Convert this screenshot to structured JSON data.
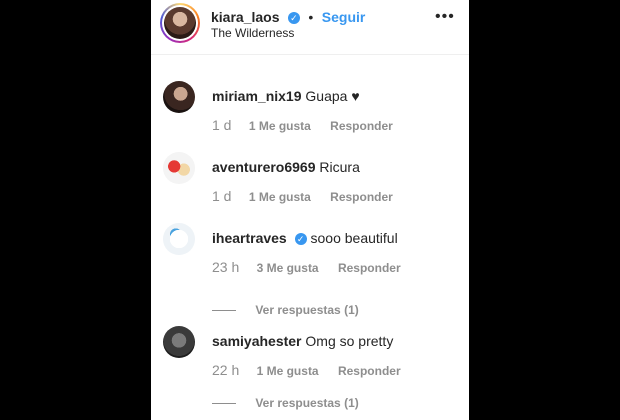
{
  "header": {
    "username": "kiara_laos",
    "verified_mark": "✓",
    "dot": "•",
    "follow_label": "Seguir",
    "location": "The Wilderness",
    "more_icon": "•••"
  },
  "comments": [
    {
      "username": "miriam_nix19",
      "text": "Guapa ♥",
      "verified": false,
      "time": "1 d",
      "likes": "1 Me gusta",
      "reply": "Responder",
      "replies": null
    },
    {
      "username": "aventurero6969",
      "text": "Ricura",
      "verified": false,
      "time": "1 d",
      "likes": "1 Me gusta",
      "reply": "Responder",
      "replies": null
    },
    {
      "username": "iheartraves",
      "text": "sooo beautiful",
      "verified": true,
      "time": "23 h",
      "likes": "3 Me gusta",
      "reply": "Responder",
      "replies": "Ver respuestas (1)"
    },
    {
      "username": "samiyahester",
      "text": "Omg so pretty",
      "verified": false,
      "time": "22 h",
      "likes": "1 Me gusta",
      "reply": "Responder",
      "replies": "Ver respuestas (1)"
    }
  ],
  "colors": {
    "accent": "#3897f0",
    "text": "#262626",
    "muted": "#8e8e8e"
  }
}
